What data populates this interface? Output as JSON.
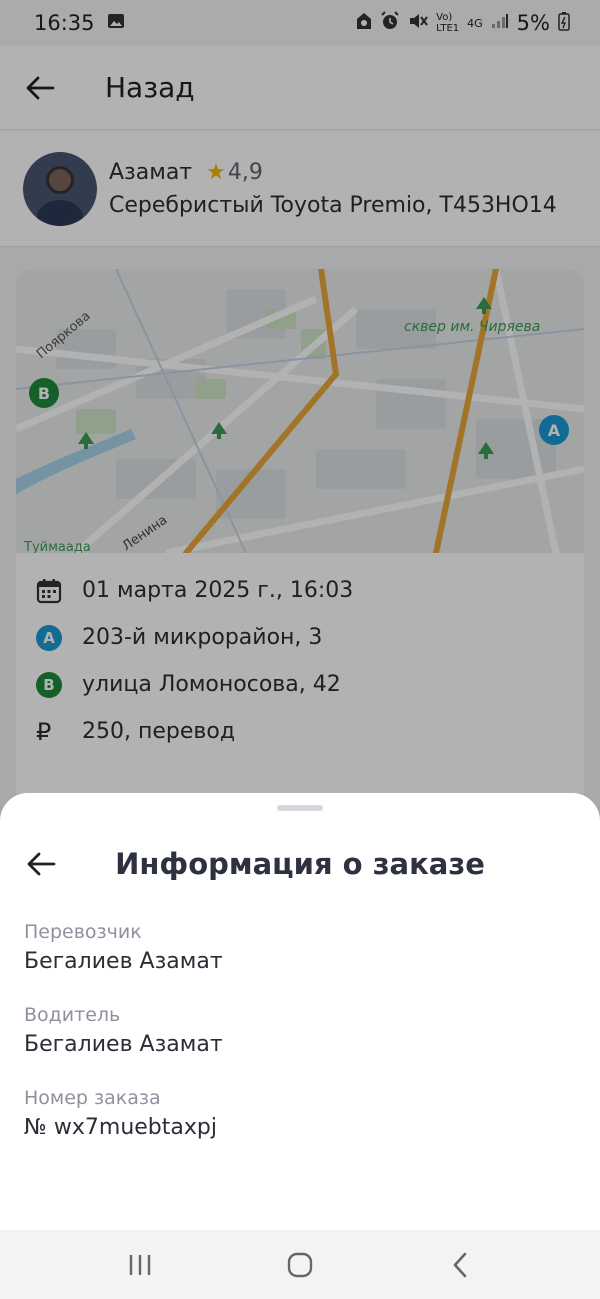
{
  "status_bar": {
    "time": "16:35",
    "net_label_top": "Vo)",
    "net_label_bottom": "LTE1",
    "network": "4G",
    "battery": "5%"
  },
  "header": {
    "back_label": "Назад"
  },
  "driver": {
    "name": "Азамат",
    "rating": "4,9",
    "car": "Серебристый Toyota Premio, Т453НО14"
  },
  "map": {
    "labels": [
      "Пояркова",
      "сквер им. Чиряева",
      "Туймаада",
      "Ленина"
    ],
    "pin_a": "A",
    "pin_b": "B"
  },
  "trip": {
    "datetime": "01 марта 2025 г., 16:03",
    "from": "203-й микрорайон, 3",
    "to": "улица Ломоносова, 42",
    "price": "250, перевод",
    "currency_symbol": "₽"
  },
  "sheet": {
    "title": "Информация о заказе",
    "fields": [
      {
        "label": "Перевозчик",
        "value": "Бегалиев Азамат"
      },
      {
        "label": "Водитель",
        "value": "Бегалиев Азамат"
      },
      {
        "label": "Номер заказа",
        "value": "№ wx7muebtaxpj"
      }
    ]
  },
  "colors": {
    "pin_a": "#1a9ad6",
    "pin_b": "#1e8a3c",
    "star": "#f2b705",
    "road_major": "#e8a63a"
  }
}
